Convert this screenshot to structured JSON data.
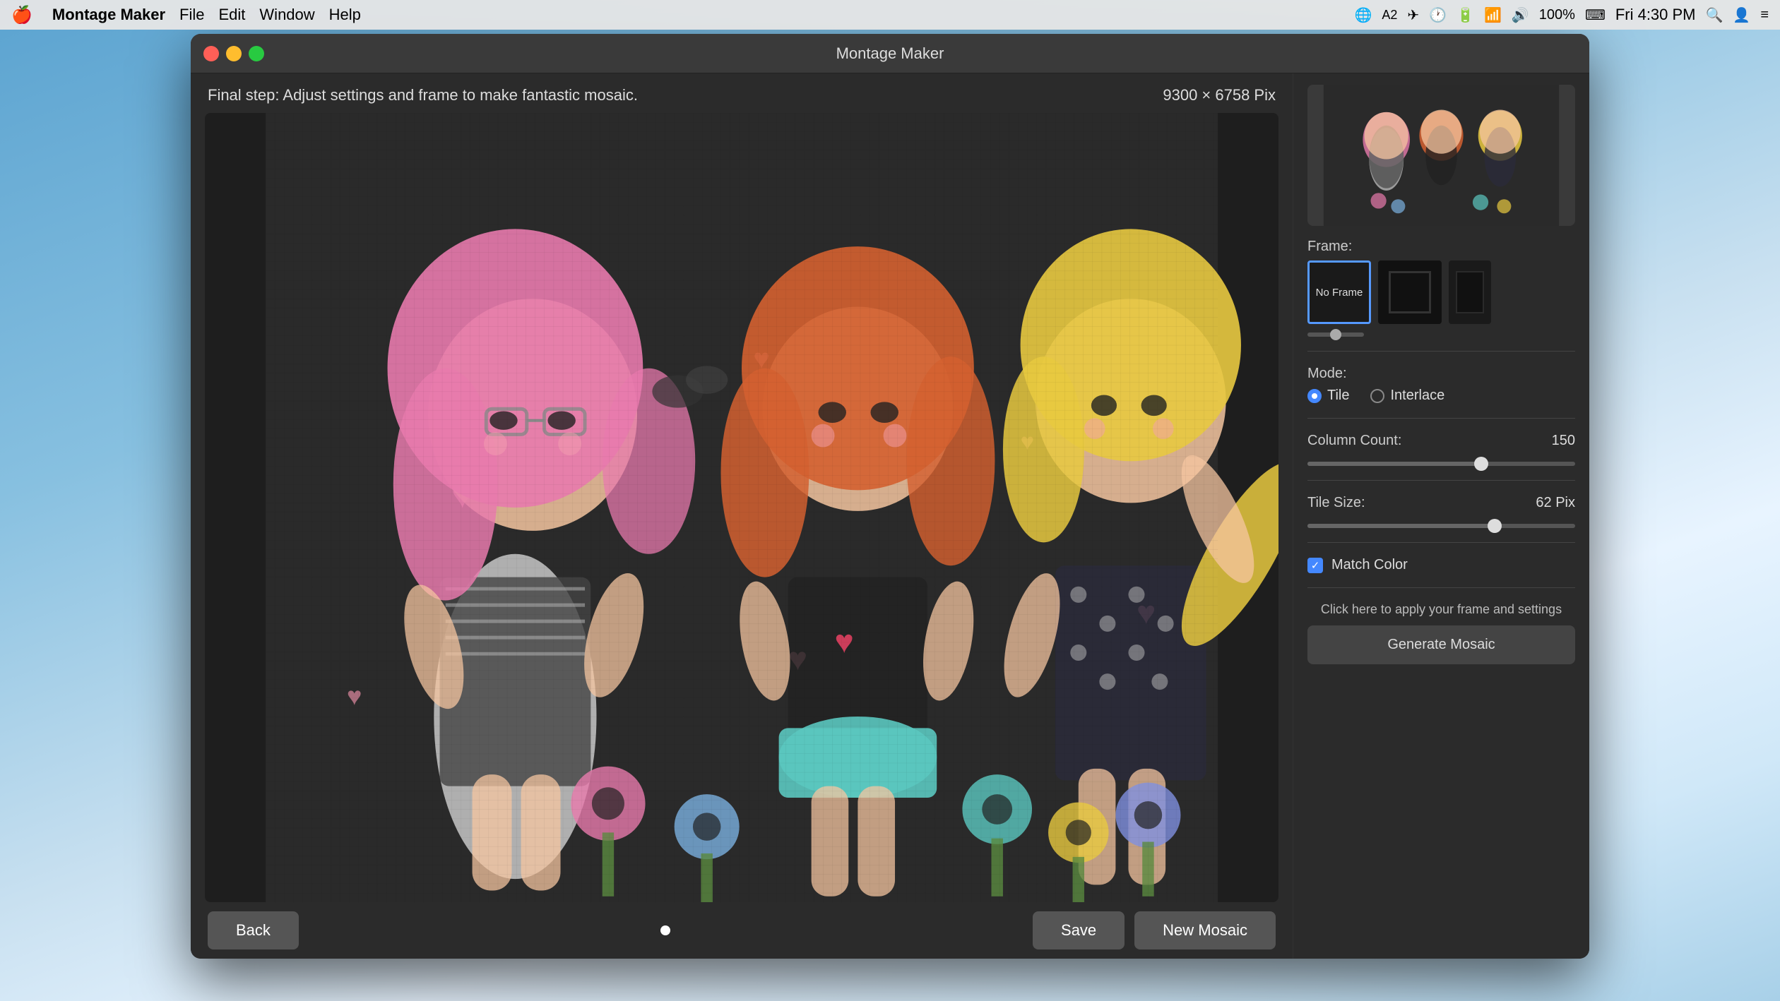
{
  "menubar": {
    "apple": "🍎",
    "app_name": "Montage Maker",
    "menus": [
      "File",
      "Edit",
      "Window",
      "Help"
    ],
    "time": "Fri 4:30 PM",
    "battery": "100%"
  },
  "window": {
    "title": "Montage Maker"
  },
  "main": {
    "instructions": "Final step: Adjust settings and frame to make fantastic mosaic.",
    "dimensions": "9300 × 6758 Pix"
  },
  "bottom": {
    "back_label": "Back",
    "save_label": "Save",
    "new_mosaic_label": "New Mosaic"
  },
  "right_panel": {
    "frame_label": "Frame:",
    "frame_options": [
      {
        "id": "none",
        "label": "No Frame",
        "selected": true
      },
      {
        "id": "dark1",
        "label": "",
        "selected": false
      },
      {
        "id": "dark2",
        "label": "",
        "selected": false
      }
    ],
    "mode_label": "Mode:",
    "modes": [
      {
        "id": "tile",
        "label": "Tile",
        "selected": true
      },
      {
        "id": "interlace",
        "label": "Interlace",
        "selected": false
      }
    ],
    "column_count_label": "Column Count:",
    "column_count_value": "150",
    "column_count_pct": 65,
    "tile_size_label": "Tile Size:",
    "tile_size_value": "62 Pix",
    "tile_size_pct": 70,
    "match_color_label": "Match Color",
    "match_color_checked": true,
    "apply_hint": "Click here to apply your frame and settings",
    "generate_label": "Generate Mosaic"
  }
}
